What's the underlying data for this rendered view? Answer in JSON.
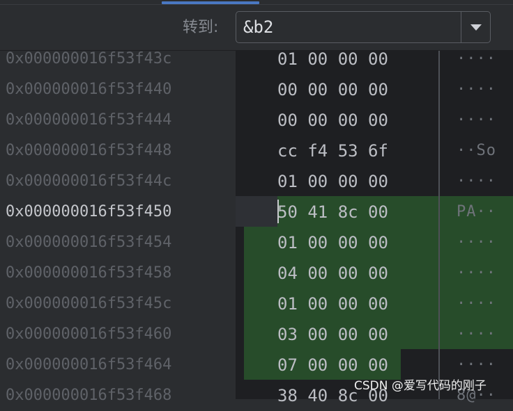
{
  "goto": {
    "label": "转到:",
    "value": "&b2"
  },
  "memory": {
    "current_address": "0x000000016f53f450",
    "rows": [
      {
        "address": "0x000000016f53f43c",
        "bytes": "01 00 00 00",
        "ascii": "····"
      },
      {
        "address": "0x000000016f53f440",
        "bytes": "00 00 00 00",
        "ascii": "····"
      },
      {
        "address": "0x000000016f53f444",
        "bytes": "00 00 00 00",
        "ascii": "····"
      },
      {
        "address": "0x000000016f53f448",
        "bytes": "cc f4 53 6f",
        "ascii": "··So"
      },
      {
        "address": "0x000000016f53f44c",
        "bytes": "01 00 00 00",
        "ascii": "····"
      },
      {
        "address": "0x000000016f53f450",
        "bytes": "50 41 8c 00",
        "ascii": "PA··"
      },
      {
        "address": "0x000000016f53f454",
        "bytes": "01 00 00 00",
        "ascii": "····"
      },
      {
        "address": "0x000000016f53f458",
        "bytes": "04 00 00 00",
        "ascii": "····"
      },
      {
        "address": "0x000000016f53f45c",
        "bytes": "01 00 00 00",
        "ascii": "····"
      },
      {
        "address": "0x000000016f53f460",
        "bytes": "03 00 00 00",
        "ascii": "····"
      },
      {
        "address": "0x000000016f53f464",
        "bytes": "07 00 00 00",
        "ascii": "····"
      },
      {
        "address": "0x000000016f53f468",
        "bytes": "38 40 8c 00",
        "ascii": "8@··"
      }
    ]
  },
  "watermark": "CSDN @爱写代码的刚子"
}
